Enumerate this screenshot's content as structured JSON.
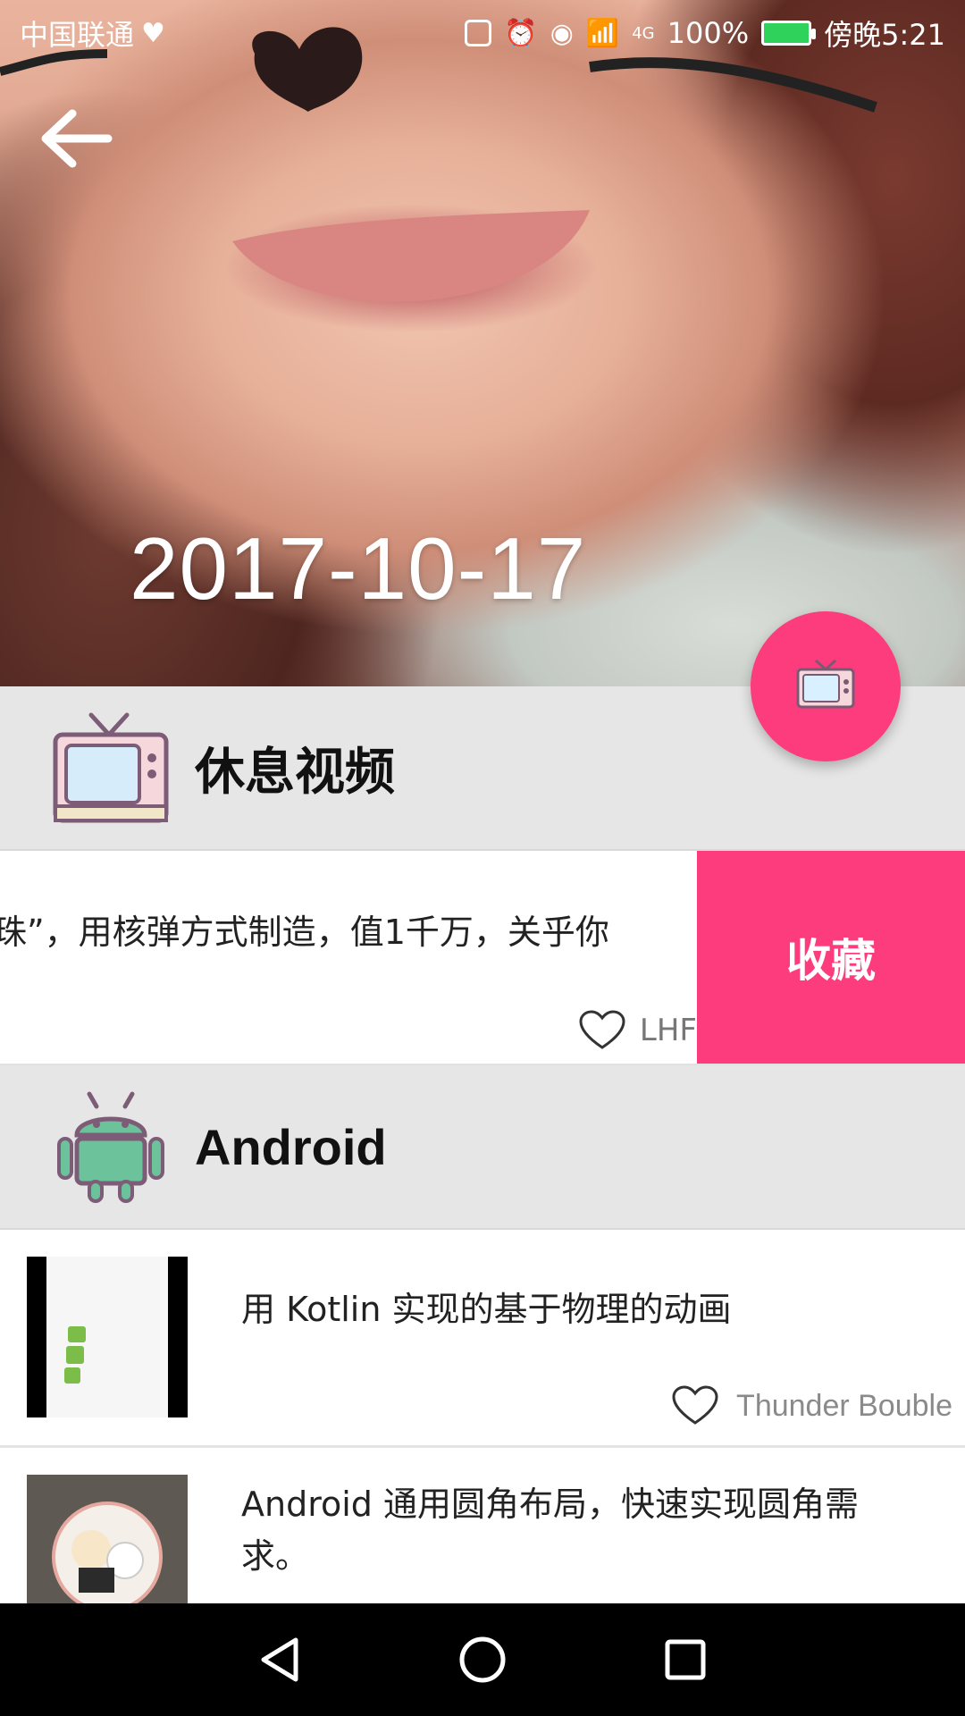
{
  "status_bar": {
    "carrier": "中国联通",
    "network": "4G",
    "battery": "100%",
    "time": "傍晚5:21"
  },
  "header": {
    "date": "2017-10-17"
  },
  "sections": [
    {
      "title": "休息视频",
      "icon": "tv-icon",
      "swipe_item": {
        "text": "珠”，用核弹方式制造，值1千万，关乎你",
        "author": "LHF",
        "action_label": "收藏"
      }
    },
    {
      "title": "Android",
      "icon": "android-icon",
      "items": [
        {
          "title": "用 Kotlin 实现的基于物理的动画",
          "author": "Thunder Bouble"
        },
        {
          "title": "Android 通用圆角布局，快速实现圆角需求。",
          "author": ""
        }
      ]
    }
  ],
  "colors": {
    "accent": "#fc3c7c",
    "section_bg": "#e6e6e6"
  }
}
